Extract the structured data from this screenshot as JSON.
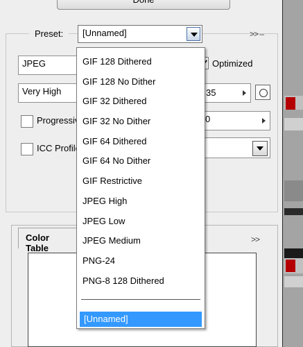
{
  "done_button": {
    "label": "Done"
  },
  "preset": {
    "label": "Preset:",
    "value": "[Unnamed]",
    "menu_icon": "double-chevron-right"
  },
  "format": {
    "value": "JPEG"
  },
  "optimized": {
    "label": "Optimized",
    "checked": true
  },
  "quality": {
    "value": "Very High",
    "number": "35"
  },
  "progressive": {
    "label": "Progressive",
    "checked": false
  },
  "blur": {
    "value": "0"
  },
  "icc_profile": {
    "label": "ICC Profile",
    "checked": false
  },
  "color_table": {
    "tab_label": "Color Table",
    "menu_icon": "double-chevron-right"
  },
  "dropdown": {
    "items": [
      "GIF 128 Dithered",
      "GIF 128 No Dither",
      "GIF 32 Dithered",
      "GIF 32 No Dither",
      "GIF 64 Dithered",
      "GIF 64 No Dither",
      "GIF Restrictive",
      "JPEG High",
      "JPEG Low",
      "JPEG Medium",
      "PNG-24",
      "PNG-8 128 Dithered"
    ],
    "selected": "[Unnamed]"
  },
  "colors": {
    "selection": "#3399ff",
    "strip_accent": "#b40000"
  }
}
